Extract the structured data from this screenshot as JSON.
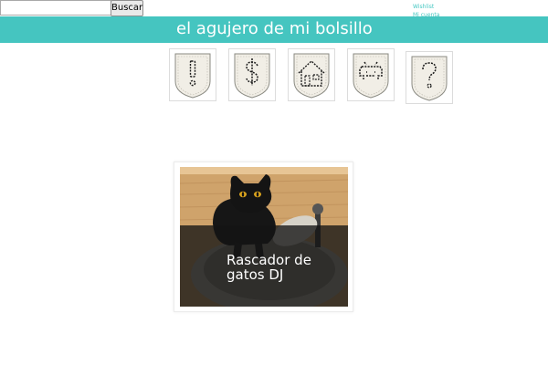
{
  "search": {
    "value": "",
    "placeholder": "",
    "button_label": "Buscar"
  },
  "account": {
    "links": [
      "Wishlist",
      "Mi cuenta"
    ]
  },
  "header": {
    "title": "el agujero de mi bolsillo",
    "color": "#45c5c0"
  },
  "nav": {
    "items": [
      {
        "icon": "exclamation-icon"
      },
      {
        "icon": "dollar-icon"
      },
      {
        "icon": "home-icon"
      },
      {
        "icon": "space-invader-icon"
      },
      {
        "icon": "question-icon"
      }
    ]
  },
  "product": {
    "title": "Rascador de gatos DJ",
    "image": "black-cat-on-turntable"
  }
}
